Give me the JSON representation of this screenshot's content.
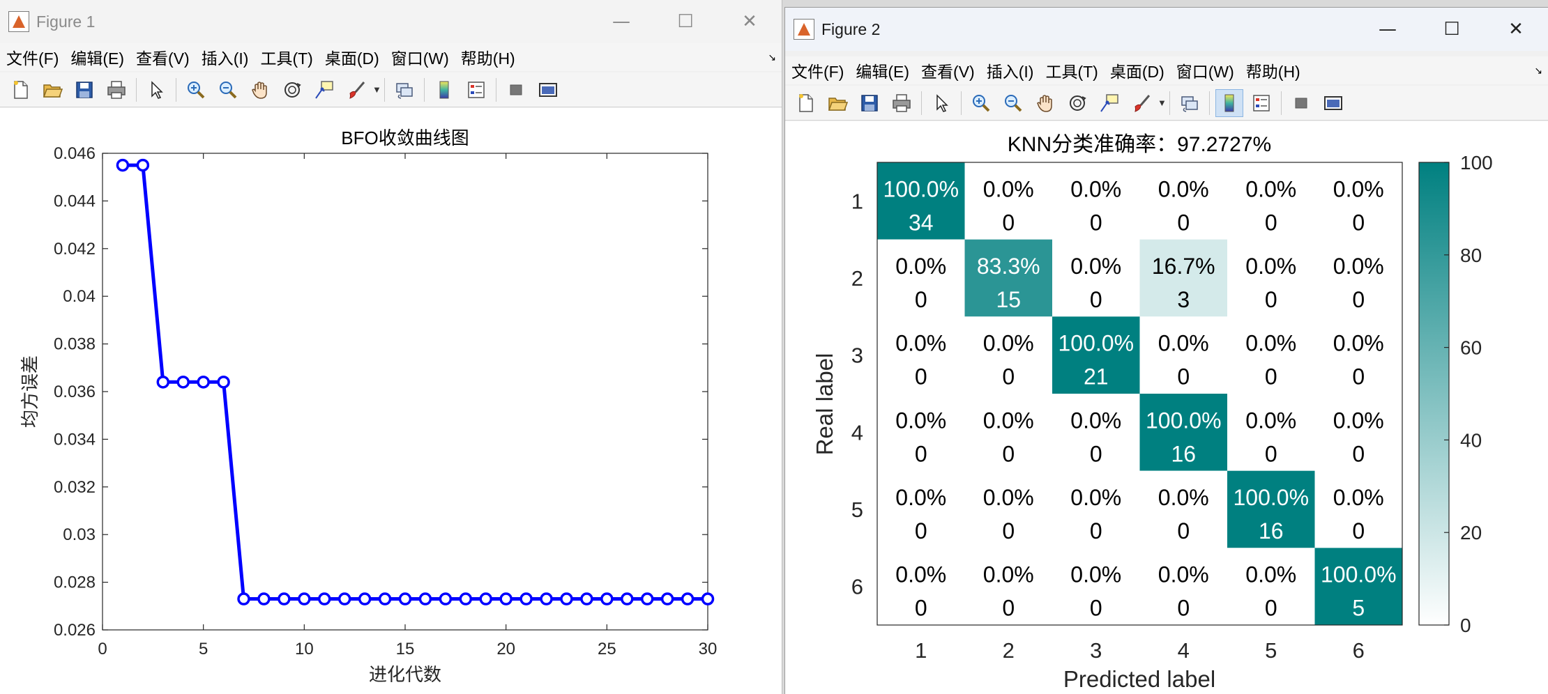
{
  "figure1": {
    "title": "Figure 1",
    "controls": {
      "minimize": "—",
      "maximize": "☐",
      "close": "✕"
    },
    "menu": [
      "文件(F)",
      "编辑(E)",
      "查看(V)",
      "插入(I)",
      "工具(T)",
      "桌面(D)",
      "窗口(W)",
      "帮助(H)"
    ],
    "toolbar": [
      "new-file-icon",
      "open-folder-icon",
      "save-icon",
      "print-icon",
      "select-cursor-icon",
      "zoom-in-icon",
      "zoom-out-icon",
      "pan-hand-icon",
      "rotate-3d-icon",
      "data-cursor-icon",
      "brush-icon",
      "link-plot-icon",
      "colorbar-icon",
      "legend-icon",
      "hide-tools-icon",
      "dock-icon"
    ],
    "chart_data": {
      "type": "line",
      "title": "BFO收敛曲线图",
      "xlabel": "进化代数",
      "ylabel": "均方误差",
      "xlim": [
        0,
        30
      ],
      "ylim": [
        0.026,
        0.046
      ],
      "xticks": [
        "0",
        "5",
        "10",
        "15",
        "20",
        "25",
        "30"
      ],
      "yticks": [
        "0.026",
        "0.028",
        "0.03",
        "0.032",
        "0.034",
        "0.036",
        "0.038",
        "0.04",
        "0.042",
        "0.044",
        "0.046"
      ],
      "color": "#0000ff",
      "marker": "circle",
      "x": [
        1,
        2,
        3,
        4,
        5,
        6,
        7,
        8,
        9,
        10,
        11,
        12,
        13,
        14,
        15,
        16,
        17,
        18,
        19,
        20,
        21,
        22,
        23,
        24,
        25,
        26,
        27,
        28,
        29,
        30
      ],
      "y": [
        0.0455,
        0.0455,
        0.0364,
        0.0364,
        0.0364,
        0.0364,
        0.0273,
        0.0273,
        0.0273,
        0.0273,
        0.0273,
        0.0273,
        0.0273,
        0.0273,
        0.0273,
        0.0273,
        0.0273,
        0.0273,
        0.0273,
        0.0273,
        0.0273,
        0.0273,
        0.0273,
        0.0273,
        0.0273,
        0.0273,
        0.0273,
        0.0273,
        0.0273,
        0.0273
      ]
    }
  },
  "figure2": {
    "title": "Figure 2",
    "controls": {
      "minimize": "—",
      "maximize": "☐",
      "close": "✕"
    },
    "menu": [
      "文件(F)",
      "编辑(E)",
      "查看(V)",
      "插入(I)",
      "工具(T)",
      "桌面(D)",
      "窗口(W)",
      "帮助(H)"
    ],
    "chart_data": {
      "type": "heatmap",
      "title": "KNN分类准确率：97.2727%",
      "xlabel": "Predicted label",
      "ylabel": "Real label",
      "x_categories": [
        "1",
        "2",
        "3",
        "4",
        "5",
        "6"
      ],
      "y_categories": [
        "1",
        "2",
        "3",
        "4",
        "5",
        "6"
      ],
      "percent_labels": [
        [
          "100.0%",
          "0.0%",
          "0.0%",
          "0.0%",
          "0.0%",
          "0.0%"
        ],
        [
          "0.0%",
          "83.3%",
          "0.0%",
          "16.7%",
          "0.0%",
          "0.0%"
        ],
        [
          "0.0%",
          "0.0%",
          "100.0%",
          "0.0%",
          "0.0%",
          "0.0%"
        ],
        [
          "0.0%",
          "0.0%",
          "0.0%",
          "100.0%",
          "0.0%",
          "0.0%"
        ],
        [
          "0.0%",
          "0.0%",
          "0.0%",
          "0.0%",
          "100.0%",
          "0.0%"
        ],
        [
          "0.0%",
          "0.0%",
          "0.0%",
          "0.0%",
          "0.0%",
          "100.0%"
        ]
      ],
      "percent_values": [
        [
          100,
          0,
          0,
          0,
          0,
          0
        ],
        [
          0,
          83.3,
          0,
          16.7,
          0,
          0
        ],
        [
          0,
          0,
          100,
          0,
          0,
          0
        ],
        [
          0,
          0,
          0,
          100,
          0,
          0
        ],
        [
          0,
          0,
          0,
          0,
          100,
          0
        ],
        [
          0,
          0,
          0,
          0,
          0,
          100
        ]
      ],
      "counts": [
        [
          "34",
          "0",
          "0",
          "0",
          "0",
          "0"
        ],
        [
          "0",
          "15",
          "0",
          "3",
          "0",
          "0"
        ],
        [
          "0",
          "0",
          "21",
          "0",
          "0",
          "0"
        ],
        [
          "0",
          "0",
          "0",
          "16",
          "0",
          "0"
        ],
        [
          "0",
          "0",
          "0",
          "0",
          "16",
          "0"
        ],
        [
          "0",
          "0",
          "0",
          "0",
          "0",
          "5"
        ]
      ],
      "colorbar_ticks": [
        "0",
        "20",
        "40",
        "60",
        "80",
        "100"
      ],
      "colorbar_range": [
        0,
        100
      ],
      "colormap": [
        "#ffffff",
        "#008080"
      ]
    }
  }
}
